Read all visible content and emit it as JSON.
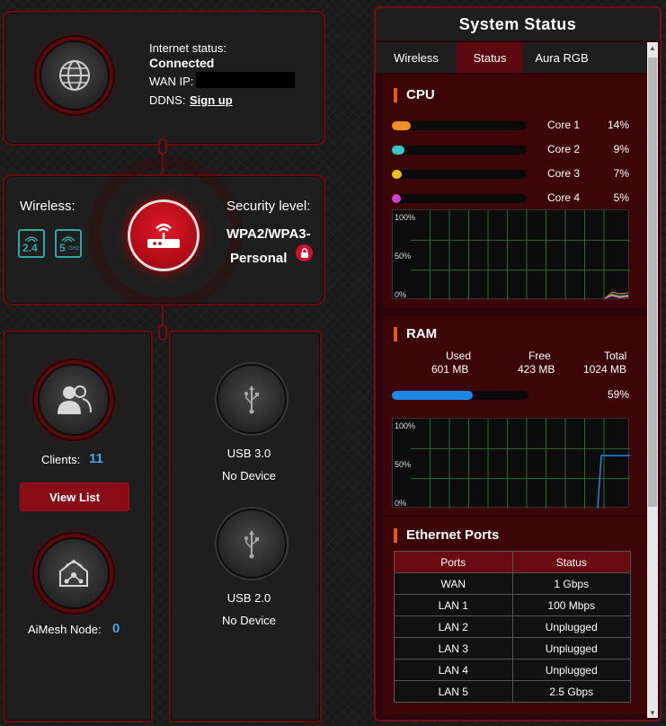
{
  "internet": {
    "status_label": "Internet status:",
    "status_value": "Connected",
    "wan_ip_label": "WAN IP:",
    "ddns_label": "DDNS:",
    "ddns_link": "Sign up"
  },
  "router": {
    "wireless_label": "Wireless:",
    "band_24": "2.4",
    "band_5": "5",
    "band_5_sub": "GHz",
    "security_label": "Security level:",
    "security_value_1": "WPA2/WPA3-",
    "security_value_2": "Personal"
  },
  "clients": {
    "label": "Clients:",
    "count": "11",
    "view_list": "View List",
    "aimesh_label": "AiMesh Node:",
    "aimesh_count": "0"
  },
  "usb": {
    "port1_name": "USB 3.0",
    "port1_status": "No Device",
    "port2_name": "USB 2.0",
    "port2_status": "No Device"
  },
  "system_status": {
    "title": "System Status",
    "tabs": [
      "Wireless",
      "Status",
      "Aura RGB"
    ],
    "active_tab": "Status",
    "cpu": {
      "title": "CPU",
      "cores": [
        {
          "name": "Core 1",
          "percent": "14%",
          "value": 14,
          "color": "#f0902a"
        },
        {
          "name": "Core 2",
          "percent": "9%",
          "value": 9,
          "color": "#3ac6c6"
        },
        {
          "name": "Core 3",
          "percent": "7%",
          "value": 7,
          "color": "#e8c020"
        },
        {
          "name": "Core 4",
          "percent": "5%",
          "value": 5,
          "color": "#d040d0"
        }
      ],
      "graph_labels": [
        "100%",
        "50%",
        "0%"
      ]
    },
    "ram": {
      "title": "RAM",
      "used_label": "Used",
      "used_value": "601 MB",
      "free_label": "Free",
      "free_value": "423 MB",
      "total_label": "Total",
      "total_value": "1024 MB",
      "percent": "59%",
      "value": 59,
      "color": "#1e88e5",
      "graph_labels": [
        "100%",
        "50%",
        "0%"
      ]
    },
    "ethernet": {
      "title": "Ethernet Ports",
      "headers": [
        "Ports",
        "Status"
      ],
      "rows": [
        [
          "WAN",
          "1 Gbps"
        ],
        [
          "LAN 1",
          "100 Mbps"
        ],
        [
          "LAN 2",
          "Unplugged"
        ],
        [
          "LAN 3",
          "Unplugged"
        ],
        [
          "LAN 4",
          "Unplugged"
        ],
        [
          "LAN 5",
          "2.5 Gbps"
        ]
      ]
    }
  }
}
